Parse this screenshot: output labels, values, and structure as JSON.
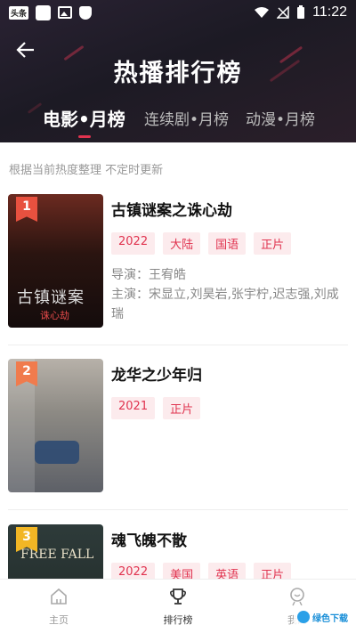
{
  "status_bar": {
    "badge": "头条",
    "time": "11:22"
  },
  "header": {
    "title": "热播排行榜",
    "tabs": [
      {
        "label": "电影•月榜",
        "active": true
      },
      {
        "label": "连续剧•月榜",
        "active": false
      },
      {
        "label": "动漫•月榜",
        "active": false
      }
    ]
  },
  "note": "根据当前热度整理 不定时更新",
  "items": [
    {
      "rank": "1",
      "title": "古镇谜案之诛心劫",
      "tags": [
        "2022",
        "大陆",
        "国语",
        "正片"
      ],
      "director": "导演：王宥皓",
      "cast": "主演：宋显立,刘昊岩,张宇柠,迟志强,刘成瑞",
      "poster_text": "古镇谜案",
      "poster_subtext": "诛心劫"
    },
    {
      "rank": "2",
      "title": "龙华之少年归",
      "tags": [
        "2021",
        "正片"
      ]
    },
    {
      "rank": "3",
      "title": "魂飞魄不散",
      "tags": [
        "2022",
        "美国",
        "英语",
        "正片"
      ],
      "poster_text": "FREE FALL"
    }
  ],
  "bottom_nav": [
    {
      "label": "主页",
      "icon": "home-icon"
    },
    {
      "label": "排行榜",
      "icon": "trophy-icon",
      "active": true
    },
    {
      "label": "我的",
      "icon": "user-icon"
    }
  ],
  "watermark": {
    "text": "绿色下载"
  },
  "colors": {
    "accent": "#e0334f",
    "tag_bg": "#fcebed",
    "header_bg": "#1c1a24",
    "rank_1": "#e8513f",
    "rank_2": "#f07b4d",
    "rank_3": "#f2b625"
  }
}
